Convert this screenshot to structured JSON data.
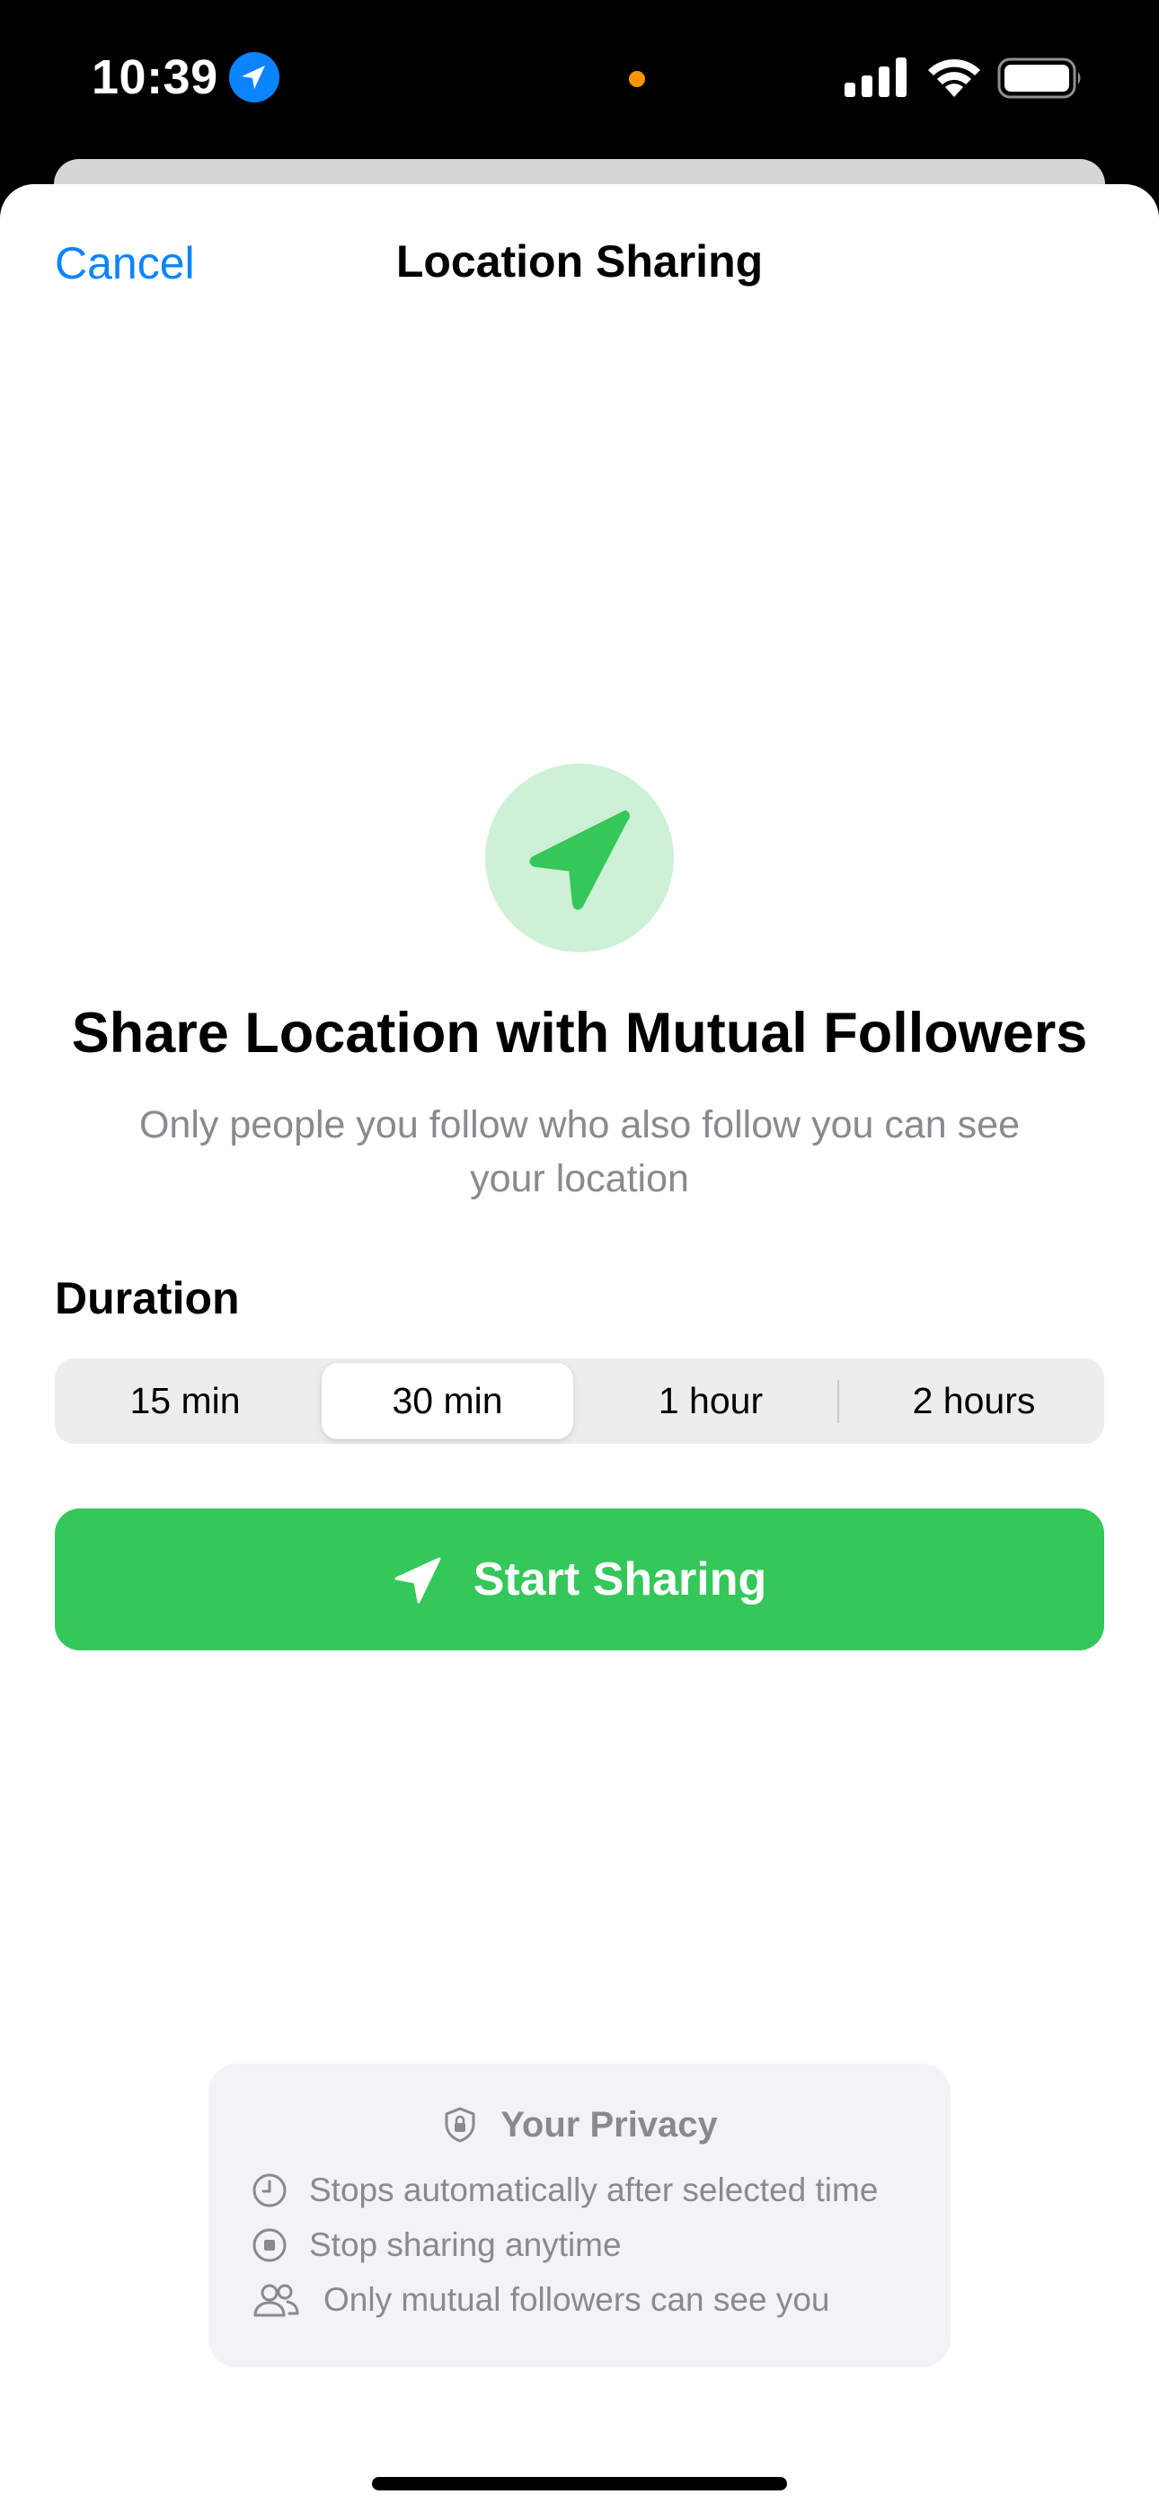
{
  "status_bar": {
    "time": "10:39",
    "icons": [
      "location-arrow-icon",
      "signal-icon",
      "wifi-icon",
      "battery-icon"
    ],
    "recording_dot_color": "#ff9500"
  },
  "nav": {
    "cancel_label": "Cancel",
    "title": "Location Sharing"
  },
  "hero": {
    "icon": "location-arrow-icon",
    "headline": "Share Location with Mutual Followers",
    "subtitle": "Only people you follow who also follow you can see your location"
  },
  "duration": {
    "label": "Duration",
    "options": [
      "15 min",
      "30 min",
      "1 hour",
      "2 hours"
    ],
    "selected": "30 min"
  },
  "start_button": {
    "label": "Start Sharing",
    "icon": "location-arrow-icon",
    "color": "#34c759"
  },
  "privacy": {
    "title": "Your Privacy",
    "title_icon": "shield-lock-icon",
    "items": [
      {
        "icon": "clock-icon",
        "text": "Stops automatically after selected time"
      },
      {
        "icon": "stop-circle-icon",
        "text": "Stop sharing anytime"
      },
      {
        "icon": "people-icon",
        "text": "Only mutual followers can see you"
      }
    ]
  },
  "colors": {
    "accent_blue": "#0a84ff",
    "green": "#34c759",
    "light_green": "#cdf0d6",
    "secondary_text": "#8a8a8e"
  }
}
